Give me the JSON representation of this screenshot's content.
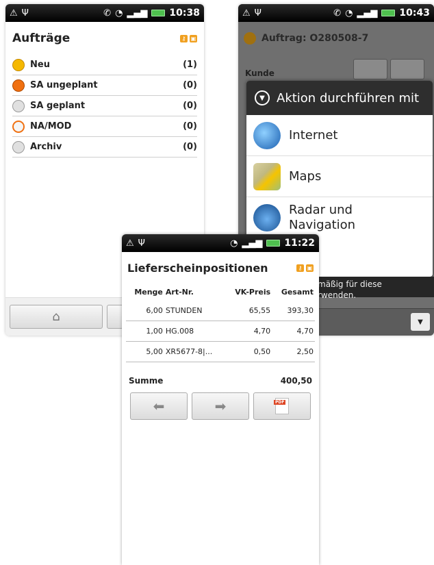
{
  "phone1": {
    "status": {
      "time": "10:38"
    },
    "title": "Aufträge",
    "items": [
      {
        "label": "Neu",
        "count": "(1)",
        "color": "#f5b800"
      },
      {
        "label": "SA ungeplant",
        "count": "(0)",
        "color": "#f07010"
      },
      {
        "label": "SA geplant",
        "count": "(0)",
        "color": "#d8d8d8"
      },
      {
        "label": "NA/MOD",
        "count": "(0)",
        "color": "#f0f0f0"
      },
      {
        "label": "Archiv",
        "count": "(0)",
        "color": "#d8d8d8"
      }
    ]
  },
  "phone2": {
    "status": {
      "time": "10:43"
    },
    "title": "Auftrag: O280508-7",
    "kunde_label": "Kunde",
    "dialog": {
      "title": "Aktion durchführen mit",
      "items": [
        {
          "label": "Internet"
        },
        {
          "label_line1": "Maps"
        },
        {
          "label_line1": "Radar und",
          "label_line2": "Navigation"
        }
      ]
    },
    "below_text_line1": "mäßig für diese",
    "below_text_line2": "rwenden."
  },
  "phone3": {
    "status": {
      "time": "11:22"
    },
    "title": "Lieferscheinpositionen",
    "columns": [
      "Menge",
      "Art-Nr.",
      "VK-Preis",
      "Gesamt"
    ],
    "rows": [
      [
        "6,00",
        "STUNDEN",
        "65,55",
        "393,30"
      ],
      [
        "1,00",
        "HG.008",
        "4,70",
        "4,70"
      ],
      [
        "5,00",
        "XR5677-8|...",
        "0,50",
        "2,50"
      ]
    ],
    "summe_label": "Summe",
    "summe_value": "400,50",
    "pdf_tag": "PDF"
  }
}
